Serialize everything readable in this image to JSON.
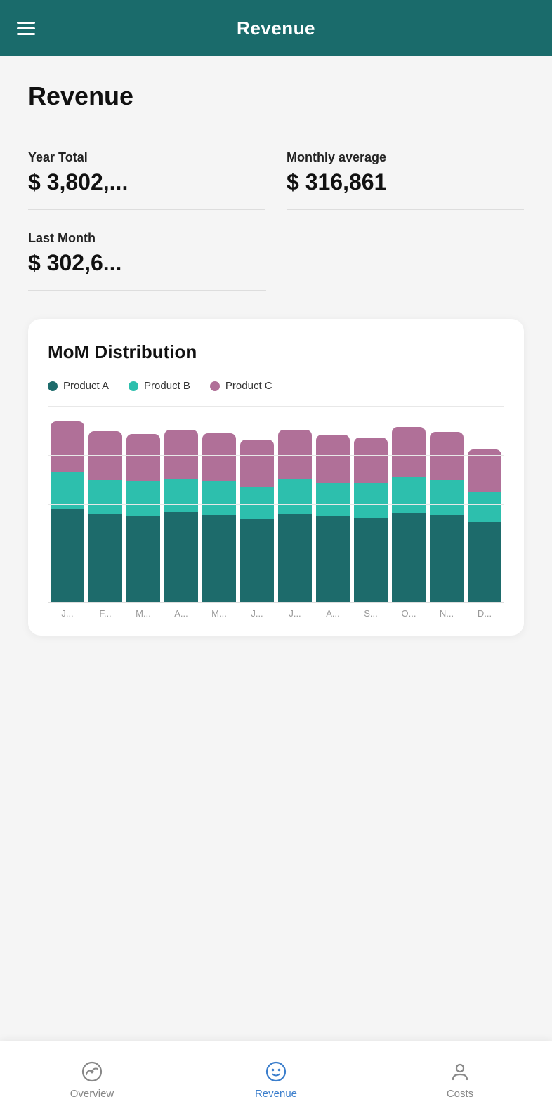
{
  "header": {
    "title": "Revenue",
    "menu_icon": "menu"
  },
  "page": {
    "title": "Revenue"
  },
  "stats": {
    "year_total_label": "Year Total",
    "year_total_value": "$ 3,802,...",
    "monthly_average_label": "Monthly average",
    "monthly_average_value": "$ 316,861",
    "last_month_label": "Last Month",
    "last_month_value": "$ 302,6..."
  },
  "chart": {
    "title": "MoM Distribution",
    "legend": [
      {
        "id": "product-a",
        "label": "Product A",
        "color": "#1d6b6b"
      },
      {
        "id": "product-b",
        "label": "Product B",
        "color": "#2dbfad"
      },
      {
        "id": "product-c",
        "label": "Product C",
        "color": "#b07098"
      }
    ],
    "months": [
      "J...",
      "F...",
      "M...",
      "A...",
      "M...",
      "J...",
      "J...",
      "A...",
      "S...",
      "O...",
      "N...",
      "D..."
    ],
    "bars": [
      {
        "a": 95,
        "b": 38,
        "c": 52
      },
      {
        "a": 90,
        "b": 35,
        "c": 50
      },
      {
        "a": 88,
        "b": 36,
        "c": 48
      },
      {
        "a": 92,
        "b": 34,
        "c": 50
      },
      {
        "a": 89,
        "b": 35,
        "c": 49
      },
      {
        "a": 85,
        "b": 33,
        "c": 48
      },
      {
        "a": 90,
        "b": 36,
        "c": 50
      },
      {
        "a": 88,
        "b": 34,
        "c": 49
      },
      {
        "a": 86,
        "b": 35,
        "c": 47
      },
      {
        "a": 91,
        "b": 37,
        "c": 51
      },
      {
        "a": 89,
        "b": 36,
        "c": 49
      },
      {
        "a": 82,
        "b": 30,
        "c": 44
      }
    ]
  },
  "bottom_nav": {
    "items": [
      {
        "id": "overview",
        "label": "Overview",
        "icon": "gauge",
        "active": false
      },
      {
        "id": "revenue",
        "label": "Revenue",
        "icon": "smiley",
        "active": true
      },
      {
        "id": "costs",
        "label": "Costs",
        "icon": "person",
        "active": false
      }
    ]
  }
}
